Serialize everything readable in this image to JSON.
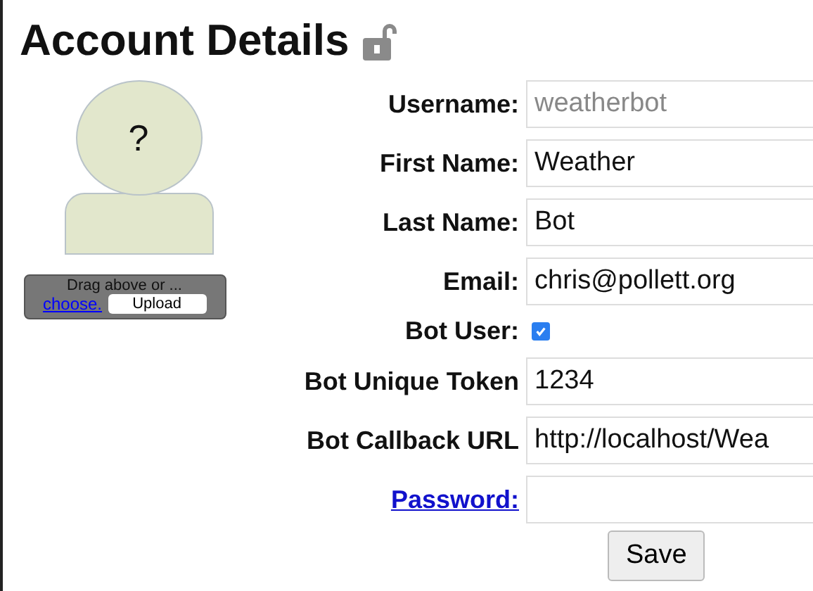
{
  "title": "Account Details",
  "avatar": {
    "placeholder_mark": "?"
  },
  "upload": {
    "hint": "Drag above or ...",
    "link": "choose.",
    "button": "Upload"
  },
  "fields": [
    {
      "kind": "text",
      "label": "Username:",
      "value": "weatherbot",
      "disabled": true
    },
    {
      "kind": "text",
      "label": "First Name:",
      "value": "Weather",
      "disabled": false
    },
    {
      "kind": "text",
      "label": "Last Name:",
      "value": "Bot",
      "disabled": false
    },
    {
      "kind": "text",
      "label": "Email:",
      "value": "chris@pollett.org",
      "disabled": false
    },
    {
      "kind": "checkbox",
      "label": "Bot User:",
      "checked": true
    },
    {
      "kind": "text",
      "label": "Bot Unique Token",
      "value": "1234",
      "disabled": false
    },
    {
      "kind": "text",
      "label": "Bot Callback URL",
      "value": "http://localhost/Wea",
      "disabled": false
    },
    {
      "kind": "link",
      "label": "Password:"
    }
  ],
  "save": "Save"
}
